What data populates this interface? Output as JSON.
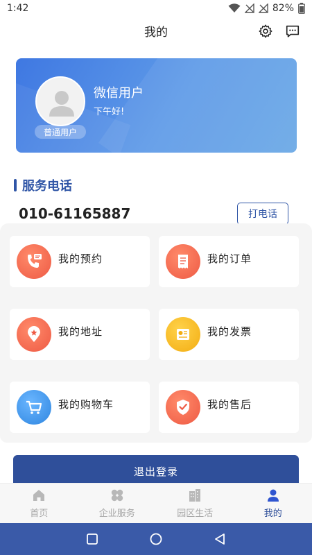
{
  "status_bar": {
    "time": "1:42",
    "battery": "82%"
  },
  "header": {
    "title": "我的"
  },
  "profile": {
    "name": "微信用户",
    "greeting": "下午好!",
    "level": "普通用户"
  },
  "service": {
    "section_title": "服务电话",
    "phone": "010-61165887",
    "call_label": "打电话"
  },
  "menu": [
    {
      "label": "我的预约",
      "icon": "phone-appointment-icon",
      "color": "#f0654e"
    },
    {
      "label": "我的订单",
      "icon": "receipt-icon",
      "color": "#f0654e"
    },
    {
      "label": "我的地址",
      "icon": "location-pin-icon",
      "color": "#f0654e"
    },
    {
      "label": "我的发票",
      "icon": "invoice-icon",
      "color": "#f5b820"
    },
    {
      "label": "我的购物车",
      "icon": "shopping-cart-icon",
      "color": "#3a8fe6"
    },
    {
      "label": "我的售后",
      "icon": "shield-check-icon",
      "color": "#f0654e"
    }
  ],
  "logout_label": "退出登录",
  "tabs": [
    {
      "label": "首页",
      "icon": "home-icon",
      "active": false
    },
    {
      "label": "企业服务",
      "icon": "clover-icon",
      "active": false
    },
    {
      "label": "园区生活",
      "icon": "buildings-icon",
      "active": false
    },
    {
      "label": "我的",
      "icon": "person-icon",
      "active": true
    }
  ],
  "colors": {
    "primary": "#2f4f9a",
    "card_gradient_start": "#3f78e2",
    "card_gradient_end": "#6aa8e6"
  }
}
